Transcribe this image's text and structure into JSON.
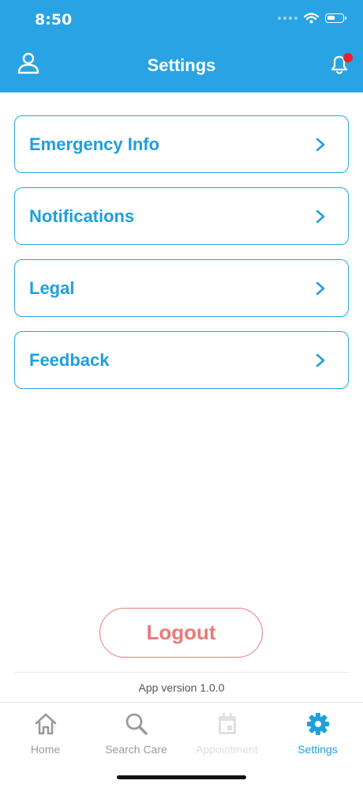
{
  "status_bar": {
    "time": "8:50"
  },
  "header": {
    "title": "Settings"
  },
  "menu": {
    "items": [
      {
        "label": "Emergency Info"
      },
      {
        "label": "Notifications"
      },
      {
        "label": "Legal"
      },
      {
        "label": "Feedback"
      }
    ]
  },
  "logout_label": "Logout",
  "app_version": "App version 1.0.0",
  "tabbar": {
    "tabs": [
      {
        "label": "Home",
        "icon": "home-icon",
        "state": "inactive"
      },
      {
        "label": "Search Care",
        "icon": "search-icon",
        "state": "inactive"
      },
      {
        "label": "Appointment",
        "icon": "calendar-icon",
        "state": "disabled"
      },
      {
        "label": "Settings",
        "icon": "gear-icon",
        "state": "active"
      }
    ]
  },
  "colors": {
    "primary": "#29a3e3",
    "logout": "#ec7878",
    "notification_dot": "#e8202a",
    "tab_inactive": "#9a9a9a",
    "tab_disabled": "#e0e0e0"
  }
}
